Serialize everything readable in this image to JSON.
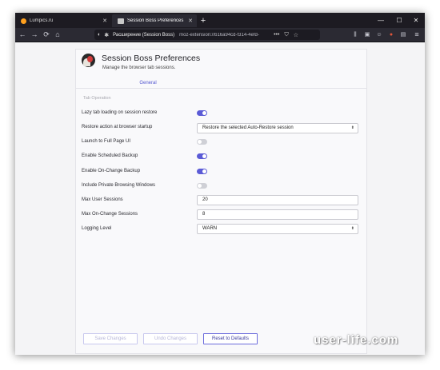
{
  "browser": {
    "tabs": [
      {
        "label": "Lumpics.ru",
        "active": false
      },
      {
        "label": "Session Boss Preferences",
        "active": true
      }
    ],
    "new_tab_symbol": "+",
    "window_controls": {
      "minimize": "—",
      "maximize": "☐",
      "close": "✕"
    },
    "nav": {
      "back": "←",
      "forward": "→",
      "reload": "⟳",
      "home": "⌂"
    },
    "address_bar": {
      "extension_label": "Расширение (Session Boss)",
      "url": "moz-extension://b16a94cd-f314-4efd-",
      "more": "•••"
    }
  },
  "page": {
    "title": "Session Boss Preferences",
    "subtitle": "Manage the browser tab sessions.",
    "tab_general": "General",
    "section_label": "Tab Operation",
    "settings": {
      "lazy_loading": {
        "label": "Lazy tab loading on session restore",
        "enabled": true
      },
      "restore_action": {
        "label": "Restore action at browser startup",
        "value": "Restore the selected Auto-Restore session"
      },
      "full_page_ui": {
        "label": "Launch to Full Page UI",
        "enabled": false
      },
      "scheduled_backup": {
        "label": "Enable Scheduled Backup",
        "enabled": true
      },
      "onchange_backup": {
        "label": "Enable On-Change Backup",
        "enabled": true
      },
      "private_windows": {
        "label": "Include Private Browsing Windows",
        "enabled": false
      },
      "max_user_sessions": {
        "label": "Max User Sessions",
        "value": "20"
      },
      "max_onchange_sessions": {
        "label": "Max On-Change Sessions",
        "value": "8"
      },
      "logging_level": {
        "label": "Logging Level",
        "value": "WARN"
      }
    },
    "buttons": {
      "save": "Save Changes",
      "undo": "Undo Changes",
      "reset": "Reset to Defaults"
    }
  },
  "watermark": "user-life.com",
  "colors": {
    "accent": "#5b5bd6",
    "toggle_off": "#cfd0d6",
    "browser_chrome": "#2b2a33"
  }
}
